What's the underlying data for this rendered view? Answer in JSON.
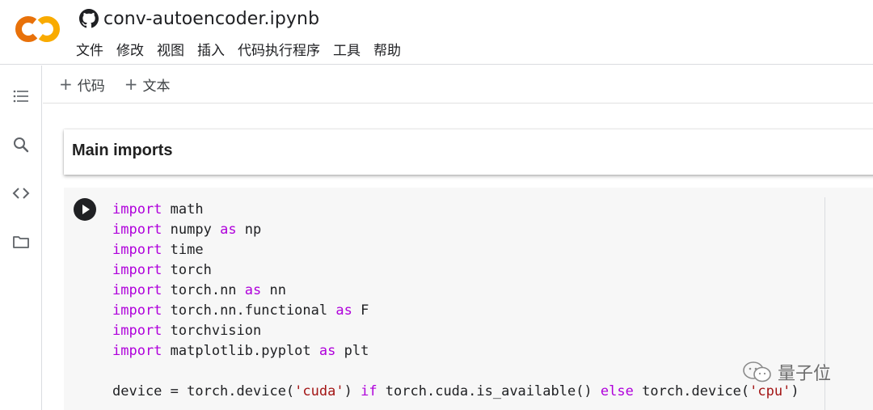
{
  "header": {
    "logo_icon": "colab-logo",
    "github_icon": "github-icon",
    "title": "conv-autoencoder.ipynb",
    "menu": [
      "文件",
      "修改",
      "视图",
      "插入",
      "代码执行程序",
      "工具",
      "帮助"
    ]
  },
  "sidebar": {
    "icons": [
      "toc-list-icon",
      "search-icon",
      "code-brackets-icon",
      "folder-icon"
    ]
  },
  "toolbar": {
    "add_code_label": "代码",
    "add_text_label": "文本"
  },
  "text_cell": {
    "heading": "Main imports"
  },
  "code_cell": {
    "lines": [
      [
        {
          "t": "import",
          "c": "kw"
        },
        {
          "t": " math"
        }
      ],
      [
        {
          "t": "import",
          "c": "kw"
        },
        {
          "t": " numpy "
        },
        {
          "t": "as",
          "c": "kw"
        },
        {
          "t": " np"
        }
      ],
      [
        {
          "t": "import",
          "c": "kw"
        },
        {
          "t": " time"
        }
      ],
      [
        {
          "t": "import",
          "c": "kw"
        },
        {
          "t": " torch"
        }
      ],
      [
        {
          "t": "import",
          "c": "kw"
        },
        {
          "t": " torch.nn "
        },
        {
          "t": "as",
          "c": "kw"
        },
        {
          "t": " nn"
        }
      ],
      [
        {
          "t": "import",
          "c": "kw"
        },
        {
          "t": " torch.nn.functional "
        },
        {
          "t": "as",
          "c": "kw"
        },
        {
          "t": " F"
        }
      ],
      [
        {
          "t": "import",
          "c": "kw"
        },
        {
          "t": " torchvision"
        }
      ],
      [
        {
          "t": "import",
          "c": "kw"
        },
        {
          "t": " matplotlib.pyplot "
        },
        {
          "t": "as",
          "c": "kw"
        },
        {
          "t": " plt"
        }
      ],
      [],
      [
        {
          "t": "device = torch.device("
        },
        {
          "t": "'cuda'",
          "c": "str"
        },
        {
          "t": ") "
        },
        {
          "t": "if",
          "c": "kw"
        },
        {
          "t": " torch.cuda.is_available() "
        },
        {
          "t": "else",
          "c": "kw"
        },
        {
          "t": " torch.device("
        },
        {
          "t": "'cpu'",
          "c": "str"
        },
        {
          "t": ")"
        }
      ]
    ]
  },
  "watermark": {
    "text": "量子位",
    "icon": "wechat-icon"
  },
  "colors": {
    "keyword": "#af00db",
    "string": "#a31515",
    "logo_orange": "#f9ab00",
    "logo_dark_orange": "#e8710a"
  }
}
